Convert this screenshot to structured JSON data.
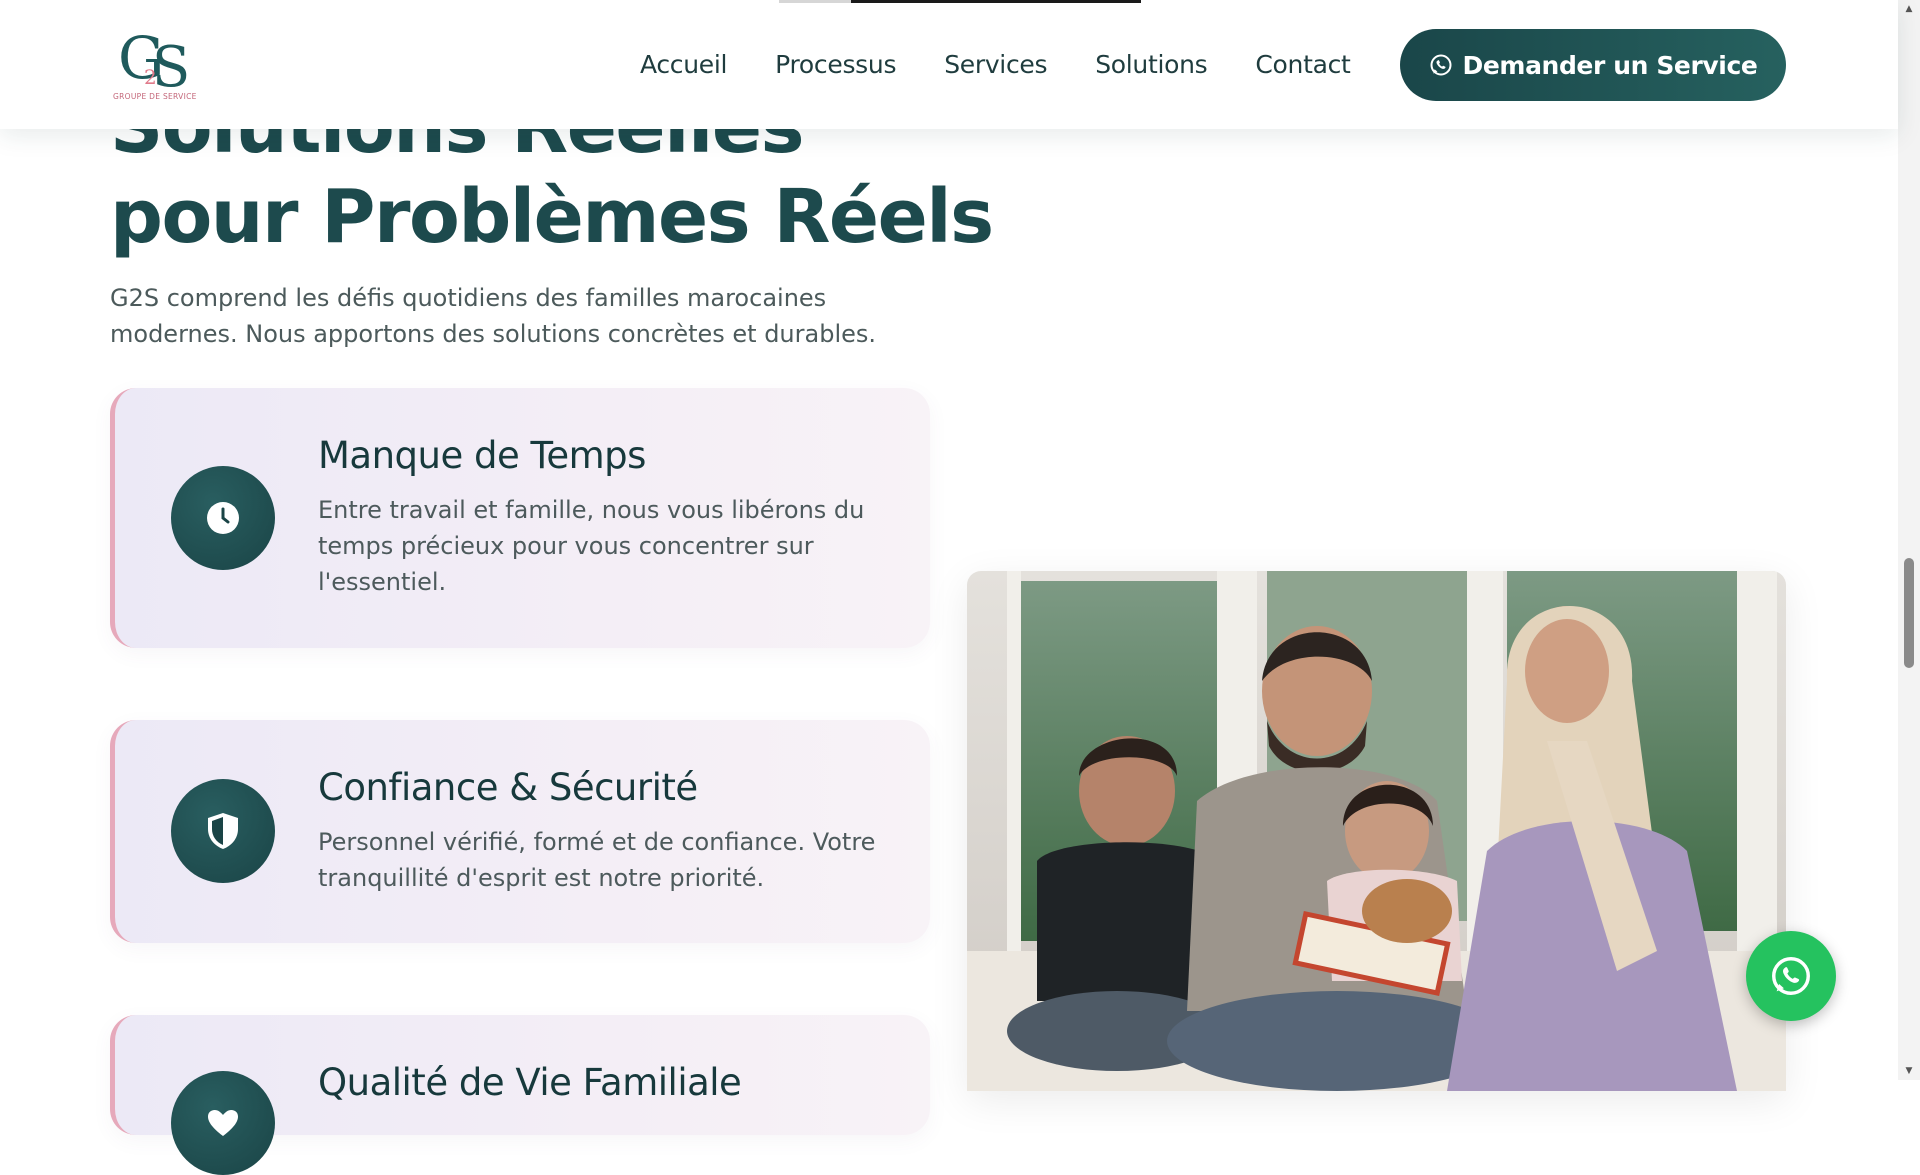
{
  "header": {
    "logo": {
      "letters": "GS",
      "small_letter": "2",
      "tagline": "GROUPE DE SERVICE"
    },
    "nav": [
      {
        "label": "Accueil"
      },
      {
        "label": "Processus"
      },
      {
        "label": "Services"
      },
      {
        "label": "Solutions"
      },
      {
        "label": "Contact"
      }
    ],
    "cta_label": "Demander un Service",
    "read_progress": 0.8
  },
  "hero": {
    "headline_line1": "Solutions Réelles",
    "headline_line2": "pour Problèmes Réels",
    "lead": "G2S comprend les défis quotidiens des familles marocaines modernes. Nous apportons des solutions concrètes et durables."
  },
  "cards": [
    {
      "title": "Manque de Temps",
      "description": "Entre travail et famille, nous vous libérons du temps précieux pour vous concentrer sur l'essentiel.",
      "icon": "clock-icon"
    },
    {
      "title": "Confiance & Sécurité",
      "description": "Personnel vérifié, formé et de confiance. Votre tranquillité d'esprit est notre priorité.",
      "icon": "shield-icon"
    },
    {
      "title": "Qualité de Vie Familiale",
      "description": "",
      "icon": "heart-icon"
    }
  ],
  "photo": {
    "subject": "family-photo"
  },
  "floating": {
    "icon": "whatsapp-icon"
  },
  "colors": {
    "brand_dark": "#1a4649",
    "brand_accent_pink": "#e6a9bb",
    "whatsapp_green": "#25c25f",
    "card_bg": "#ece9f6"
  }
}
